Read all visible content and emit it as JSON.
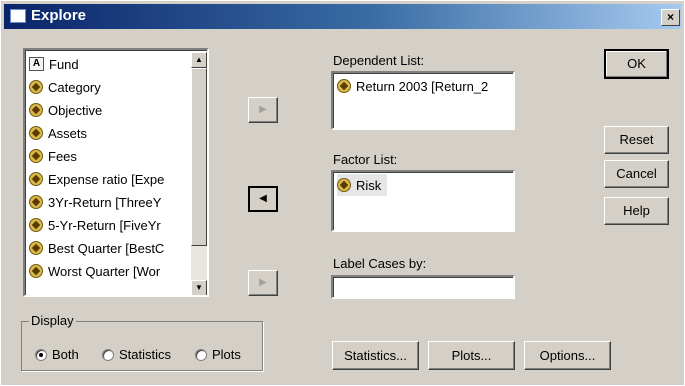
{
  "window": {
    "title": "Explore",
    "close_glyph": "×"
  },
  "variables": {
    "items": [
      {
        "label": "Fund",
        "icon": "string-variable-icon"
      },
      {
        "label": "Category",
        "icon": "scale-variable-icon"
      },
      {
        "label": "Objective",
        "icon": "scale-variable-icon"
      },
      {
        "label": "Assets",
        "icon": "scale-variable-icon"
      },
      {
        "label": "Fees",
        "icon": "scale-variable-icon"
      },
      {
        "label": "Expense ratio [Expe",
        "icon": "scale-variable-icon"
      },
      {
        "label": "3Yr-Return [ThreeY",
        "icon": "scale-variable-icon"
      },
      {
        "label": "5-Yr-Return [FiveYr",
        "icon": "scale-variable-icon"
      },
      {
        "label": "Best Quarter [BestC",
        "icon": "scale-variable-icon"
      },
      {
        "label": "Worst Quarter [Wor",
        "icon": "scale-variable-icon"
      }
    ],
    "string_icon_text": "A"
  },
  "transfer": {
    "right_arrow": "▶",
    "left_arrow": "◀"
  },
  "dependent": {
    "label": "Dependent List:",
    "items": [
      "Return 2003 [Return_2"
    ]
  },
  "factor": {
    "label": "Factor List:",
    "items": [
      "Risk"
    ]
  },
  "label_cases": {
    "label": "Label Cases by:",
    "value": ""
  },
  "buttons": {
    "ok": "OK",
    "reset": "Reset",
    "cancel": "Cancel",
    "help": "Help",
    "statistics": "Statistics...",
    "plots": "Plots...",
    "options": "Options..."
  },
  "display": {
    "title": "Display",
    "options": [
      "Both",
      "Statistics",
      "Plots"
    ],
    "selected": "Both"
  },
  "colors": {
    "title_bar_start": "#0a246a",
    "title_bar_end": "#a6caf0",
    "dialog_bg": "#d4d0c8"
  }
}
